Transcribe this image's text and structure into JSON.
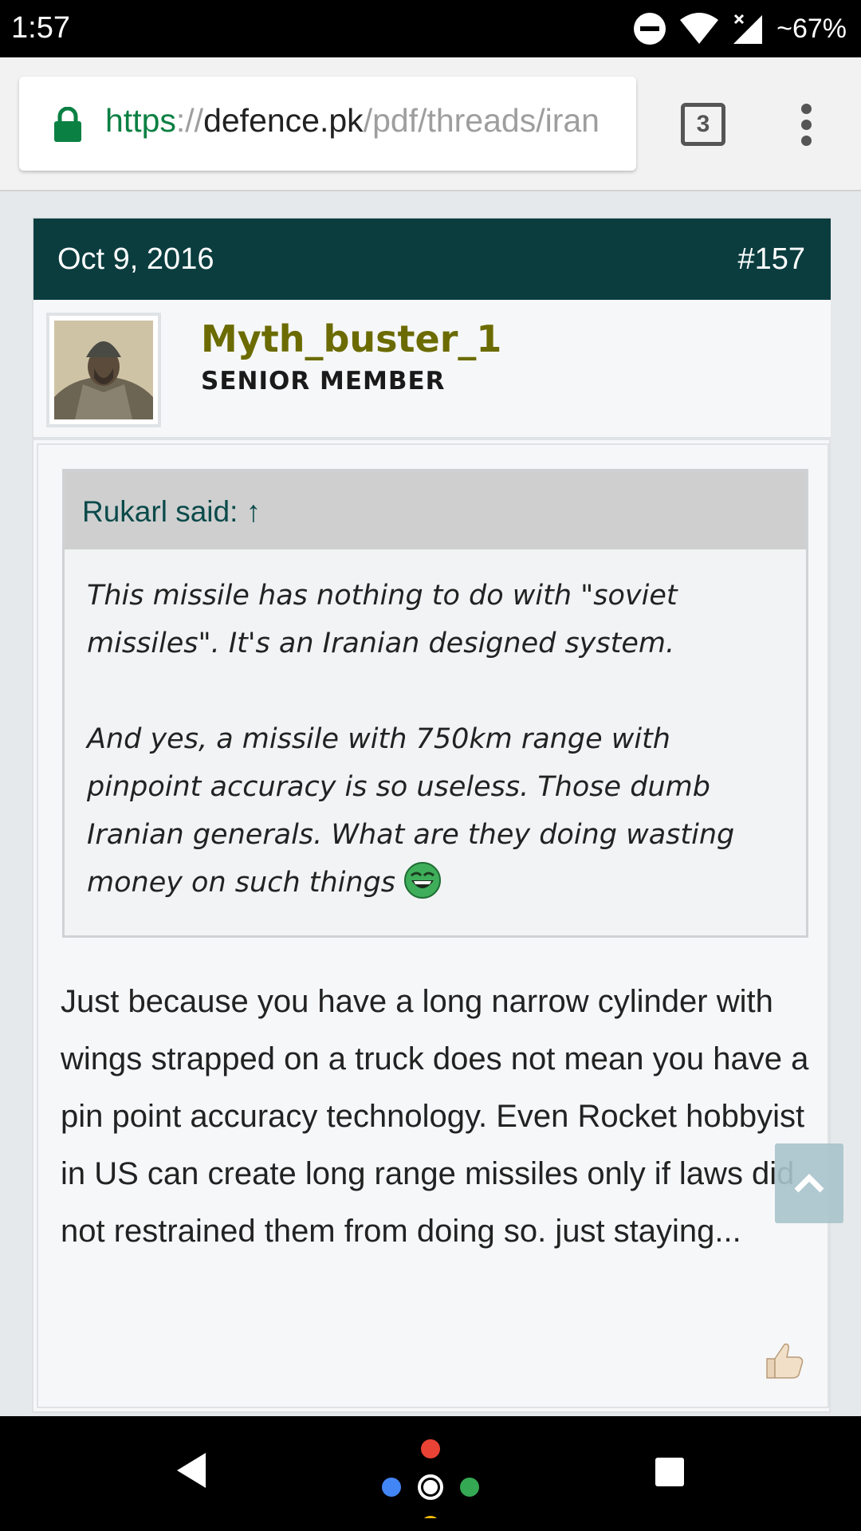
{
  "status_bar": {
    "time": "1:57",
    "battery": "~67%",
    "icons": [
      "do-not-disturb-icon",
      "wifi-icon",
      "signal-icon",
      "battery-text"
    ]
  },
  "browser": {
    "url_scheme": "https",
    "url_separator": "://",
    "url_host": "defence.pk",
    "url_path": "/pdf/threads/iran",
    "tab_count": "3",
    "colors": {
      "secure": "#0b8043",
      "toolbar": "#f2f2f2"
    }
  },
  "post": {
    "date": "Oct 9, 2016",
    "number": "#157",
    "header_color": "#0b3d3f",
    "author": {
      "name": "Myth_buster_1",
      "title": "SENIOR MEMBER",
      "name_color": "#6b6b00"
    },
    "quote": {
      "author_line": "Rukarl said: ↑",
      "paragraph_1": "This missile has nothing to do with \"soviet missiles\". It's an Iranian designed system.",
      "paragraph_2": "And yes, a missile with 750km range with pinpoint accuracy is so useless. Those dumb Iranian generals. What are they doing wasting money on such things"
    },
    "body": "Just because you have a long narrow cylinder with wings strapped on a truck does not mean you have a pin point accuracy technology. Even Rocket hobbyist in US can create long range missiles only if laws did not restrained them from doing so. just staying..."
  }
}
